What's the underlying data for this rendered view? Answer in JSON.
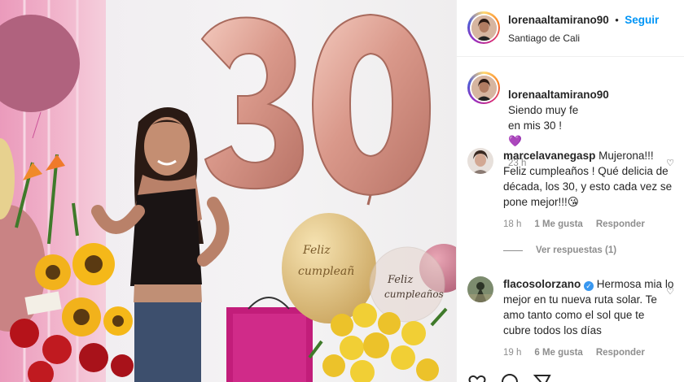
{
  "post": {
    "username": "lorenaaltamirano90",
    "separator": "•",
    "follow_label": "Seguir",
    "location": "Santiago de Cali",
    "caption_text": "Siendo muy fe\nen mis 30 !",
    "caption_emoji": "💜",
    "caption_time": "23 h"
  },
  "photo": {
    "balloon_number": "30",
    "balloon_text_1": "Feliz",
    "balloon_text_2": "cumpleañ",
    "balloon_text_3": "Feliz",
    "balloon_text_4": "cumpleaños"
  },
  "comments": [
    {
      "username": "marcelavanegasp",
      "text": "Mujerona!!! Feliz cumpleaños ! Qué delicia de década, los 30, y esto cada vez se pone mejor!!!",
      "emoji": "😘",
      "time": "18 h",
      "likes": "1 Me gusta",
      "reply": "Responder"
    },
    {
      "username": "flacosolorzano",
      "text": "Hermosa mia lo mejor en tu nueva ruta solar. Te amo tanto como el sol que te cubre todos los días",
      "time": "19 h",
      "likes": "6 Me gusta",
      "reply": "Responder"
    }
  ],
  "view_replies": "Ver respuestas (1)",
  "colors": {
    "accent": "#0095f6",
    "muted": "#8e8e8e",
    "verified": "#3897f0"
  }
}
